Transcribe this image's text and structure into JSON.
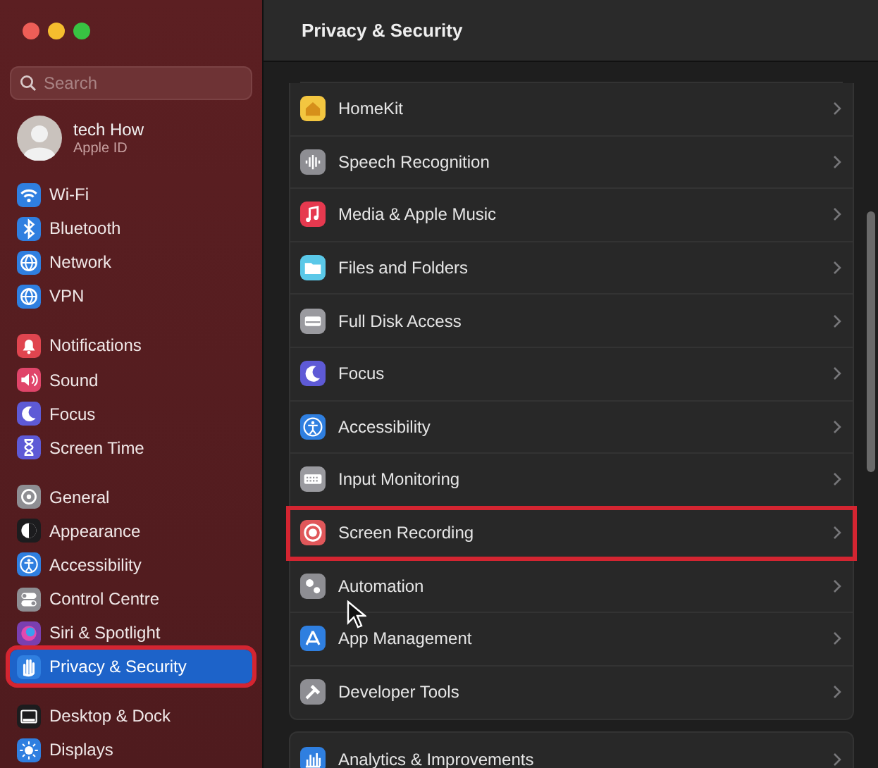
{
  "sidebar": {
    "search": {
      "placeholder": "Search"
    },
    "profile": {
      "name": "tech How",
      "subtitle": "Apple ID"
    },
    "groups": [
      [
        {
          "label": "Wi-Fi",
          "kind": "wifi",
          "color": "#2f7fe0",
          "selected": false,
          "highlighted": false
        },
        {
          "label": "Bluetooth",
          "kind": "bluetooth",
          "color": "#2f7fe0",
          "selected": false,
          "highlighted": false
        },
        {
          "label": "Network",
          "kind": "globe",
          "color": "#2f7fe0",
          "selected": false,
          "highlighted": false
        },
        {
          "label": "VPN",
          "kind": "globe",
          "color": "#2f7fe0",
          "selected": false,
          "highlighted": false
        }
      ],
      [
        {
          "label": "Notifications",
          "kind": "bell",
          "color": "#e0454f",
          "selected": false,
          "highlighted": false
        },
        {
          "label": "Sound",
          "kind": "speaker",
          "color": "#e0456a",
          "selected": false,
          "highlighted": false
        },
        {
          "label": "Focus",
          "kind": "moon",
          "color": "#5e5ad6",
          "selected": false,
          "highlighted": false
        },
        {
          "label": "Screen Time",
          "kind": "hourglass",
          "color": "#5e5ad6",
          "selected": false,
          "highlighted": false
        }
      ],
      [
        {
          "label": "General",
          "kind": "gear",
          "color": "#8e8e93",
          "selected": false,
          "highlighted": false
        },
        {
          "label": "Appearance",
          "kind": "contrast",
          "color": "#1c1c1e",
          "selected": false,
          "highlighted": false
        },
        {
          "label": "Accessibility",
          "kind": "person",
          "color": "#2f7fe0",
          "selected": false,
          "highlighted": false
        },
        {
          "label": "Control Centre",
          "kind": "toggle",
          "color": "#8e8e93",
          "selected": false,
          "highlighted": false
        },
        {
          "label": "Siri & Spotlight",
          "kind": "orb",
          "color": "#7a3fb0",
          "selected": false,
          "highlighted": false
        },
        {
          "label": "Privacy & Security",
          "kind": "hand",
          "color": "#2f7fe0",
          "selected": true,
          "highlighted": true
        }
      ],
      [
        {
          "label": "Desktop & Dock",
          "kind": "dock",
          "color": "#1c1c1e",
          "selected": false,
          "highlighted": false
        },
        {
          "label": "Displays",
          "kind": "sun",
          "color": "#2f7fe0",
          "selected": false,
          "highlighted": false
        }
      ]
    ]
  },
  "main": {
    "title": "Privacy & Security",
    "sections": [
      [
        {
          "label": "HomeKit",
          "kind": "house",
          "color": "#f3c640",
          "highlighted": false
        },
        {
          "label": "Speech Recognition",
          "kind": "waveform",
          "color": "#8e8e93",
          "highlighted": false
        },
        {
          "label": "Media & Apple Music",
          "kind": "note",
          "color": "#e6394f",
          "highlighted": false
        },
        {
          "label": "Files and Folders",
          "kind": "folder",
          "color": "#5ac8e8",
          "highlighted": false
        },
        {
          "label": "Full Disk Access",
          "kind": "disk",
          "color": "#9a9a9f",
          "highlighted": false
        },
        {
          "label": "Focus",
          "kind": "moon",
          "color": "#5e5ad6",
          "highlighted": false
        },
        {
          "label": "Accessibility",
          "kind": "person",
          "color": "#2f7fe0",
          "highlighted": false
        },
        {
          "label": "Input Monitoring",
          "kind": "keyboard",
          "color": "#9a9a9f",
          "highlighted": false
        },
        {
          "label": "Screen Recording",
          "kind": "record",
          "color": "#e0575a",
          "highlighted": true
        },
        {
          "label": "Automation",
          "kind": "gears",
          "color": "#8e8e93",
          "highlighted": false
        },
        {
          "label": "App Management",
          "kind": "triangle",
          "color": "#2f7fe0",
          "highlighted": false
        },
        {
          "label": "Developer Tools",
          "kind": "hammer",
          "color": "#8e8e93",
          "highlighted": false
        }
      ],
      [
        {
          "label": "Analytics & Improvements",
          "kind": "chart",
          "color": "#2f7fe0",
          "highlighted": false
        }
      ]
    ]
  }
}
